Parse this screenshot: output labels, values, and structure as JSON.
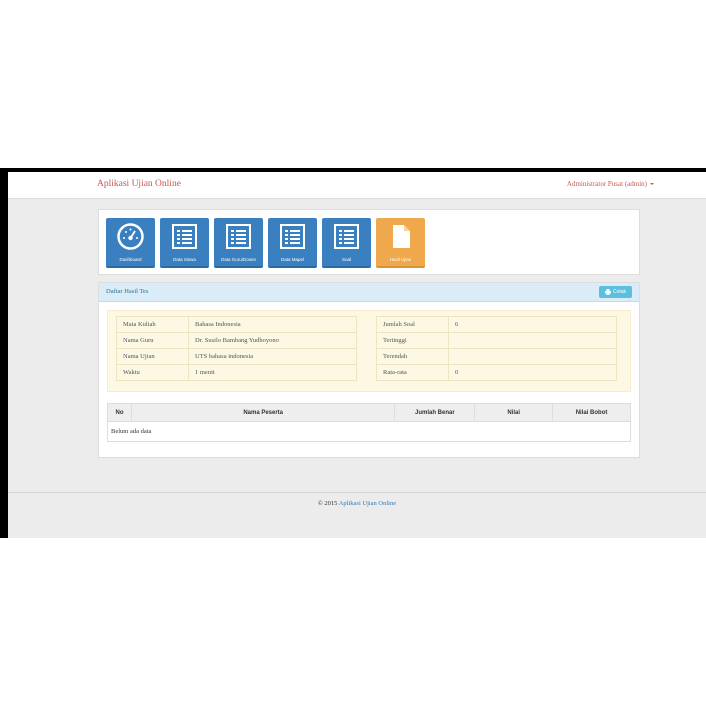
{
  "app": {
    "brand": "Aplikasi Ujian Online",
    "user_menu": "Administrator Pusat (admin)"
  },
  "tiles": [
    {
      "label": "Dashboard",
      "icon": "gauge-icon",
      "color": "#3a7fc0"
    },
    {
      "label": "Data Siswa",
      "icon": "list-icon",
      "color": "#3a7fc0"
    },
    {
      "label": "Data Guru/Dosen",
      "icon": "list-icon",
      "color": "#3a7fc0"
    },
    {
      "label": "Data Mapel",
      "icon": "list-icon",
      "color": "#3a7fc0"
    },
    {
      "label": "Soal",
      "icon": "list-icon",
      "color": "#3a7fc0"
    },
    {
      "label": "Hasil Ujian",
      "icon": "document-icon",
      "color": "#efa84b"
    }
  ],
  "panel": {
    "title": "Daftar Hasil Tes",
    "print_label": "Cetak"
  },
  "info": {
    "left": [
      {
        "label": "Mata Kuliah",
        "value": "Bahasa Indonesia"
      },
      {
        "label": "Nama Guru",
        "value": "Dr. Susilo Bambang Yudhoyono"
      },
      {
        "label": "Nama Ujian",
        "value": "UTS bahasa indonesia"
      },
      {
        "label": "Waktu",
        "value": "1 menit"
      }
    ],
    "right": [
      {
        "label": "Jumlah Soal",
        "value": "6"
      },
      {
        "label": "Tertinggi",
        "value": ""
      },
      {
        "label": "Terendah",
        "value": ""
      },
      {
        "label": "Rata-rata",
        "value": "0"
      }
    ]
  },
  "results": {
    "headers": [
      "No",
      "Nama Peserta",
      "Jumlah Benar",
      "Nilai",
      "Nilai Bobot"
    ],
    "empty_text": "Belum ada data"
  },
  "footer": {
    "prefix": "© 2015",
    "link": "Aplikasi Ujian Online"
  }
}
